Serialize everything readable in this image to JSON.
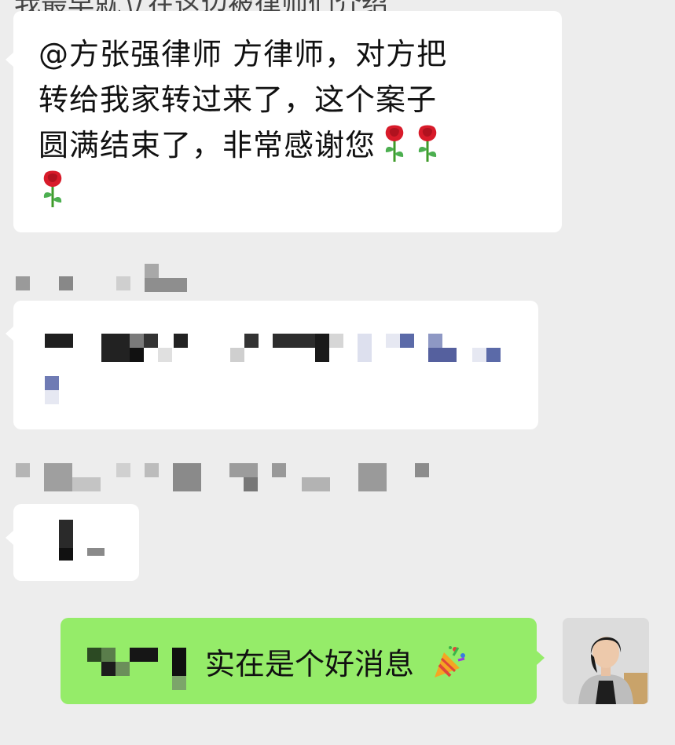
{
  "top_cut_line": {
    "text": "我最早就立在这边被律师们介绍"
  },
  "message_1": {
    "line_1": "@方张强律师 方律师，对方把",
    "line_2": "转给我家转过来了，这个案子",
    "line_3": "圆满结束了，非常感谢您",
    "emoji": "rose-emoji"
  },
  "message_2": {
    "content": "[redacted]"
  },
  "message_3": {
    "content": "[redacted]"
  },
  "my_message": {
    "text": "实在是个好消息",
    "emoji": "party-popper-emoji"
  },
  "colors": {
    "background": "#ededed",
    "incoming_bubble": "#ffffff",
    "outgoing_bubble": "#95ec69"
  }
}
